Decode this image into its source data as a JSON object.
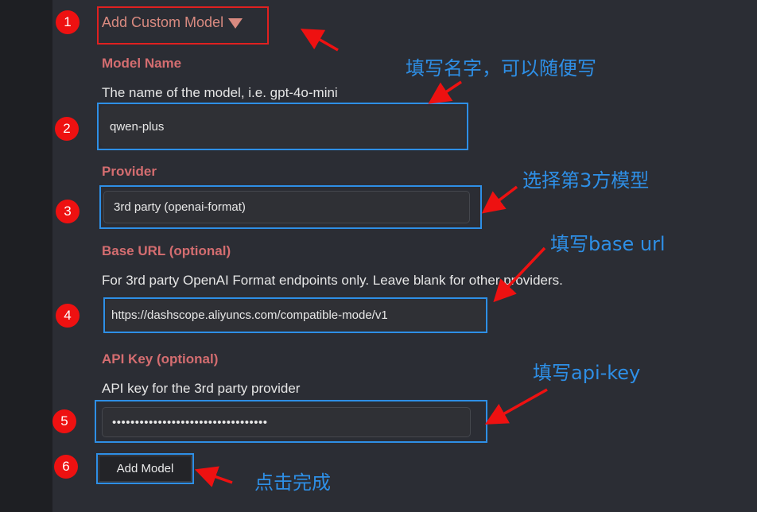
{
  "form": {
    "toggle_label": "Add Custom Model",
    "model_name": {
      "label": "Model Name",
      "description": "The name of the model, i.e. gpt-4o-mini",
      "value": "qwen-plus"
    },
    "provider": {
      "label": "Provider",
      "value": "3rd party (openai-format)"
    },
    "base_url": {
      "label": "Base URL (optional)",
      "description": "For 3rd party OpenAI Format endpoints only. Leave blank for other providers.",
      "value": "https://dashscope.aliyuncs.com/compatible-mode/v1"
    },
    "api_key": {
      "label": "API Key (optional)",
      "description": "API key for the 3rd party provider",
      "value": "••••••••••••••••••••••••••••••••••"
    },
    "add_button": "Add Model"
  },
  "annotations": {
    "badges": [
      "1",
      "2",
      "3",
      "4",
      "5",
      "6"
    ],
    "notes": {
      "name": "填写名字，可以随便写",
      "provider": "选择第3方模型",
      "base_url": "填写base url",
      "api_key": "填写api-key",
      "done": "点击完成"
    },
    "colors": {
      "annotation_red": "#ee1111",
      "annotation_blue": "#2e8fe6"
    }
  }
}
